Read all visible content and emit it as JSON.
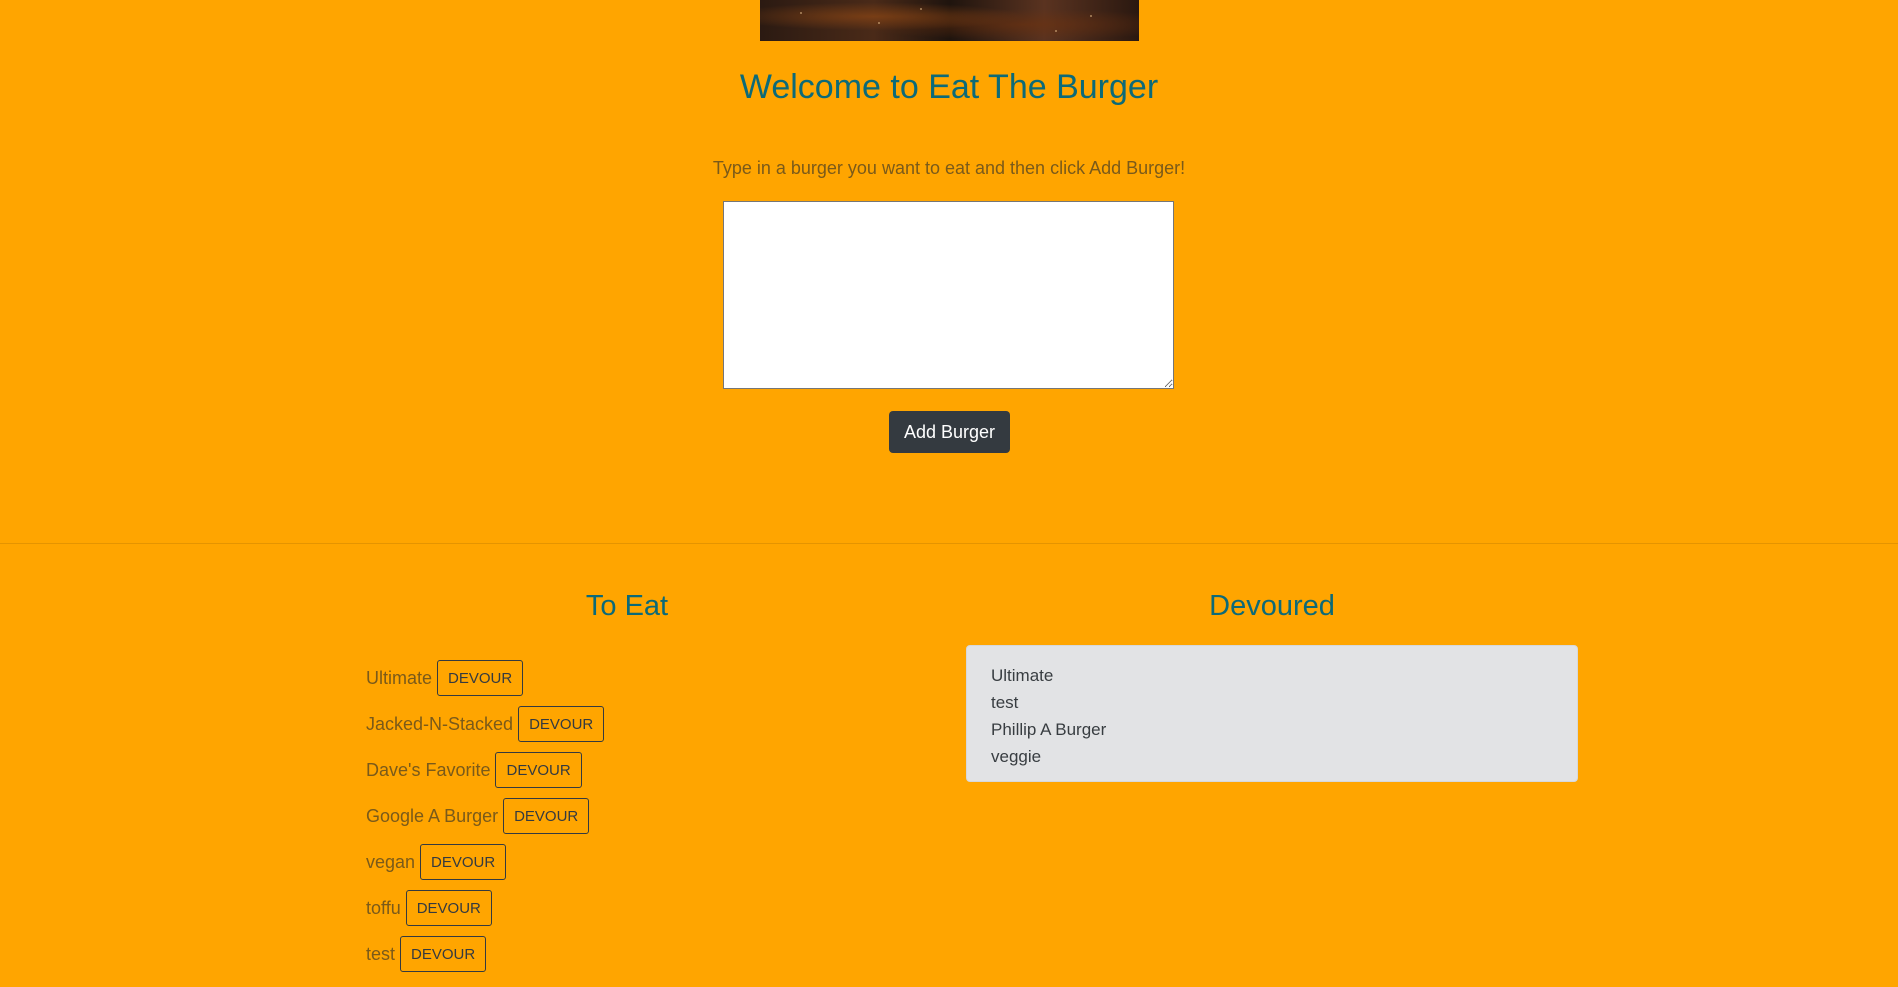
{
  "header": {
    "title": "Welcome to Eat The Burger",
    "instructions": "Type in a burger you want to eat and then click Add Burger!"
  },
  "form": {
    "textarea_value": "",
    "add_button_label": "Add Burger"
  },
  "to_eat": {
    "heading": "To Eat",
    "devour_label": "DEVOUR",
    "items": [
      {
        "name": "Ultimate"
      },
      {
        "name": "Jacked-N-Stacked"
      },
      {
        "name": "Dave's Favorite"
      },
      {
        "name": "Google A Burger"
      },
      {
        "name": "vegan"
      },
      {
        "name": "toffu"
      },
      {
        "name": "test"
      }
    ]
  },
  "devoured": {
    "heading": "Devoured",
    "items": [
      "Ultimate",
      "test",
      "Phillip A Burger",
      "veggie"
    ]
  },
  "colors": {
    "background": "#FFA500",
    "heading": "#0c6a78",
    "button_dark": "#343a40",
    "devoured_box": "#e2e3e5"
  }
}
